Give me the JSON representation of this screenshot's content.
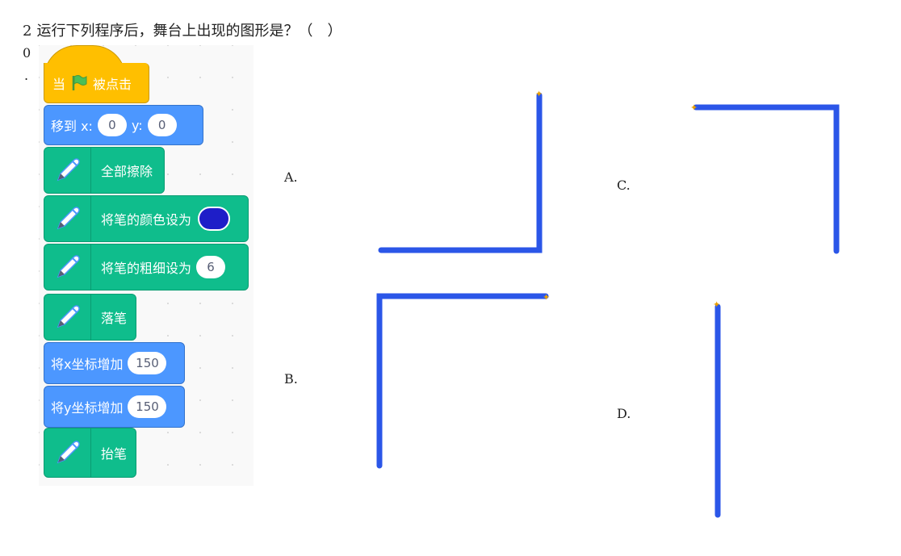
{
  "question": {
    "number": "2",
    "text": "运行下列程序后，舞台上出现的图形是？（　）",
    "side_zero": "0",
    "side_dot": "."
  },
  "blocks": {
    "when_flag_pre": "当",
    "when_flag_post": "被点击",
    "goto_label": "移到 x:",
    "goto_x": "0",
    "goto_y_label": "y:",
    "goto_y": "0",
    "clear": "全部擦除",
    "set_color": "将笔的颜色设为",
    "set_size": "将笔的粗细设为",
    "set_size_value": "6",
    "pen_down": "落笔",
    "change_x": "将x坐标增加",
    "change_x_value": "150",
    "change_y": "将y坐标增加",
    "change_y_value": "150",
    "pen_up": "抬笔"
  },
  "colors": {
    "event": "#FFBF00",
    "motion": "#4C97FF",
    "pen": "#0FBD8C",
    "pen_color": "#1E1EC8",
    "stroke": "#2B56E8"
  },
  "options": {
    "a": "A.",
    "b": "B.",
    "c": "C.",
    "d": "D."
  }
}
